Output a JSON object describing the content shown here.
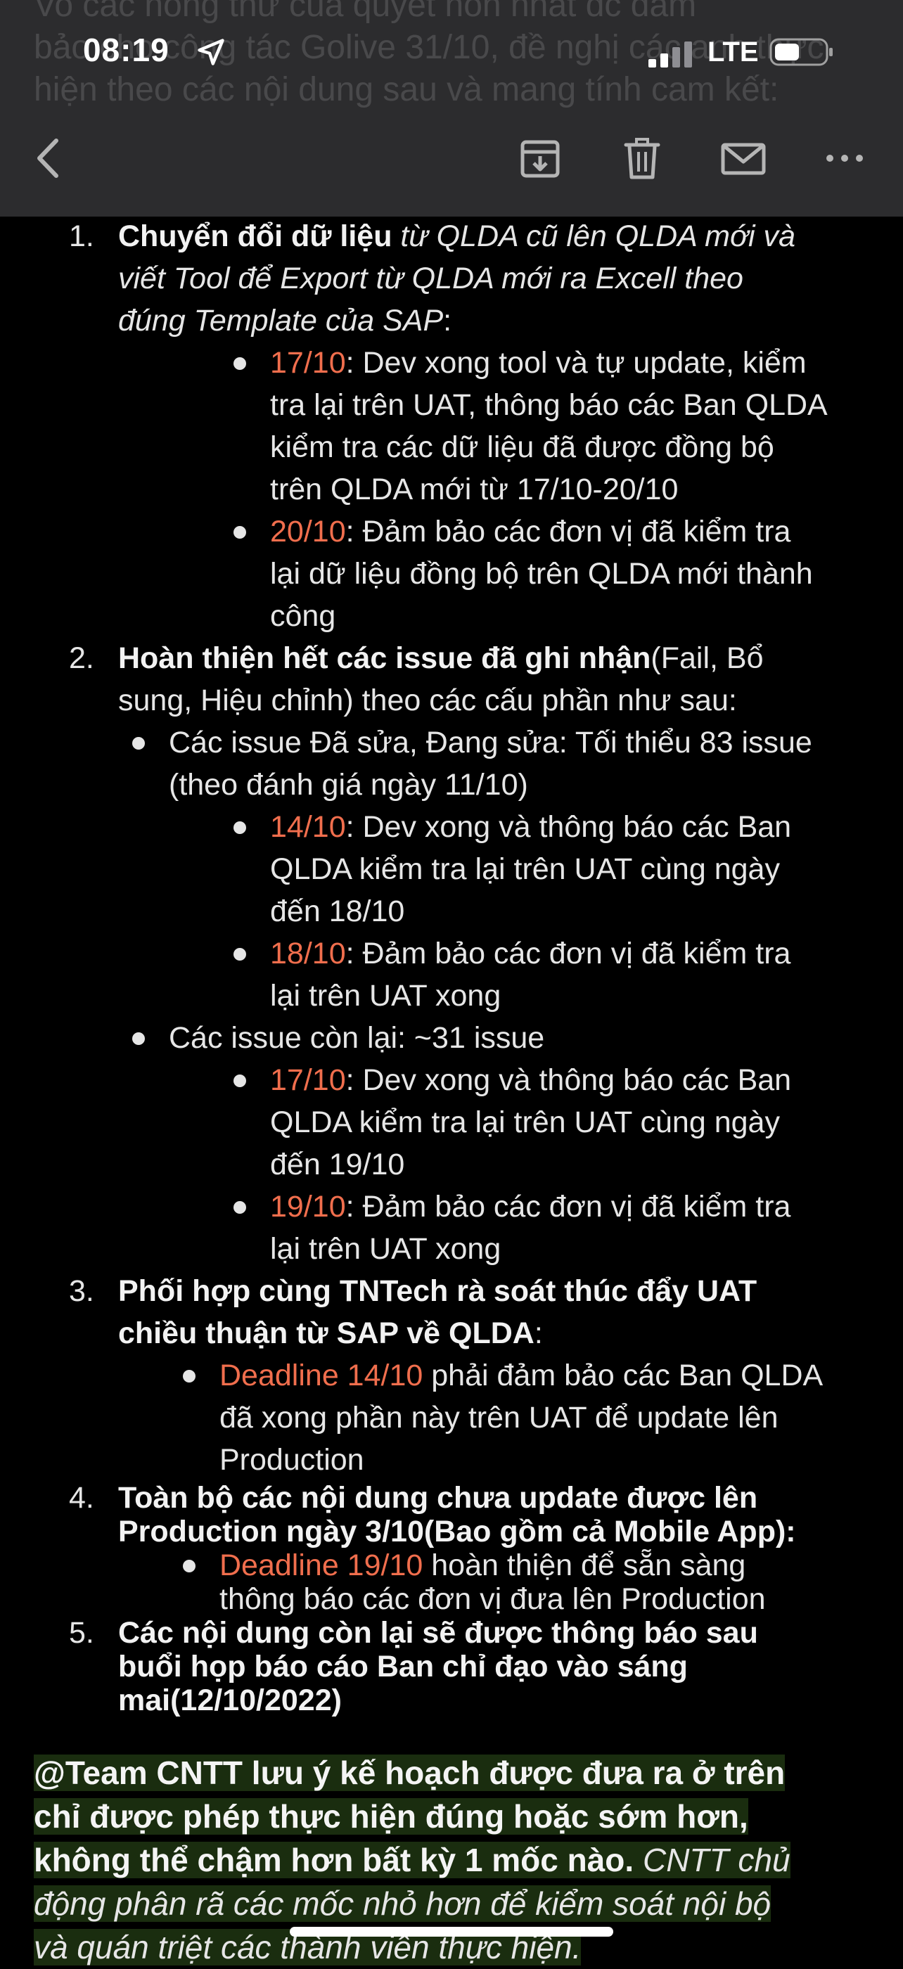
{
  "status_bar": {
    "time": "08:19",
    "network": "LTE"
  },
  "ghost_lines": [
    "Vo các nông thứ của quyết hon nhất đc đảm",
    "bảo cho công tác Golive 31/10, đề nghị các anh thực",
    "hiện theo các nội dung sau và mang tính cam kết:"
  ],
  "toolbar": {
    "back_icon": "chevron-left-icon",
    "archive_icon": "archive-icon",
    "trash_icon": "trash-icon",
    "mail_icon": "envelope-icon",
    "more_icon": "ellipsis-icon"
  },
  "items": {
    "i1": {
      "num": "1.",
      "bold": "Chuyển đổi dữ liệu",
      "ital_a": " từ QLDA cũ lên QLDA mới và",
      "ital_b": "viết Tool để Export từ QLDA mới ra Excell theo",
      "ital_c": "đúng Template của SAP",
      "colon": ":",
      "b1_date": "17/10",
      "b1_l1": ": Dev xong tool và tự update, kiểm",
      "b1_l2": "tra lại trên UAT, thông báo các Ban QLDA",
      "b1_l3": "kiểm tra các dữ liệu đã được đồng bộ",
      "b1_l4": "trên QLDA mới từ 17/10-20/10",
      "b2_date": "20/10",
      "b2_l1": ": Đảm bảo các đơn vị đã kiểm tra",
      "b2_l2": "lại dữ liệu đồng bộ trên QLDA mới thành",
      "b2_l3": "công"
    },
    "i2": {
      "num": "2.",
      "bold": "Hoàn thiện hết các issue đã ghi nhận",
      "rest_a": "(Fail, Bổ",
      "rest_b": "sung, Hiệu chỉnh) theo các cấu phần như sau:",
      "s1_l1": "Các issue Đã sửa, Đang sửa: Tối thiểu 83 issue",
      "s1_l2": "(theo đánh giá ngày 11/10)",
      "s1b1_date": "14/10",
      "s1b1_l1": ": Dev xong và thông báo các Ban",
      "s1b1_l2": "QLDA kiểm tra lại trên UAT cùng ngày",
      "s1b1_l3": "đến 18/10",
      "s1b2_date": "18/10",
      "s1b2_l1": ": Đảm bảo các đơn vị đã kiểm tra",
      "s1b2_l2": "lại trên UAT xong",
      "s2_l1": "Các issue còn lại: ~31 issue",
      "s2b1_date": "17/10",
      "s2b1_l1": ": Dev xong và thông báo các Ban",
      "s2b1_l2": "QLDA kiểm tra lại trên UAT cùng ngày",
      "s2b1_l3": "đến 19/10",
      "s2b2_date": "19/10",
      "s2b2_l1": ": Đảm bảo các đơn vị đã kiểm tra",
      "s2b2_l2": "lại trên UAT xong"
    },
    "i3": {
      "num": "3.",
      "bold_a": "Phối hợp cùng TNTech rà soát thúc đẩy UAT",
      "bold_b": "chiều thuận từ SAP về QLDA",
      "colon": ":",
      "b1_date": "Deadline 14/10",
      "b1_l1": " phải đảm bảo các Ban QLDA",
      "b1_l2": "đã xong phần này trên UAT để update lên",
      "b1_l3": "Production"
    },
    "i4": {
      "num": "4.",
      "bold_a": "Toàn bộ các nội dung chưa update được lên",
      "bold_b": "Production ngày 3/10(Bao gồm cả Mobile App):",
      "b1_date": "Deadline 19/10",
      "b1_l1": " hoàn thiện để sẵn sàng",
      "b1_l2": "thông báo các đơn vị đưa lên Production"
    },
    "i5": {
      "num": "5.",
      "bold_a": "Các nội dung còn lại sẽ được thông báo sau",
      "bold_b": "buổi họp báo cáo Ban chỉ đạo vào sáng",
      "bold_c": "mai(12/10/2022)"
    }
  },
  "note": {
    "l1": "@Team CNTT lưu ý kế hoạch được đưa ra ở trên",
    "l2": "chỉ được phép thực hiện đúng hoặc sớm hơn,",
    "l3_bold": "không thể chậm hơn bất kỳ 1 mốc nào.",
    "l3_ital": " CNTT chủ",
    "l4": "động phân rã các mốc nhỏ hơn để kiểm soát nội bộ",
    "l5": "và quán triệt các thành viên thực hiện."
  }
}
